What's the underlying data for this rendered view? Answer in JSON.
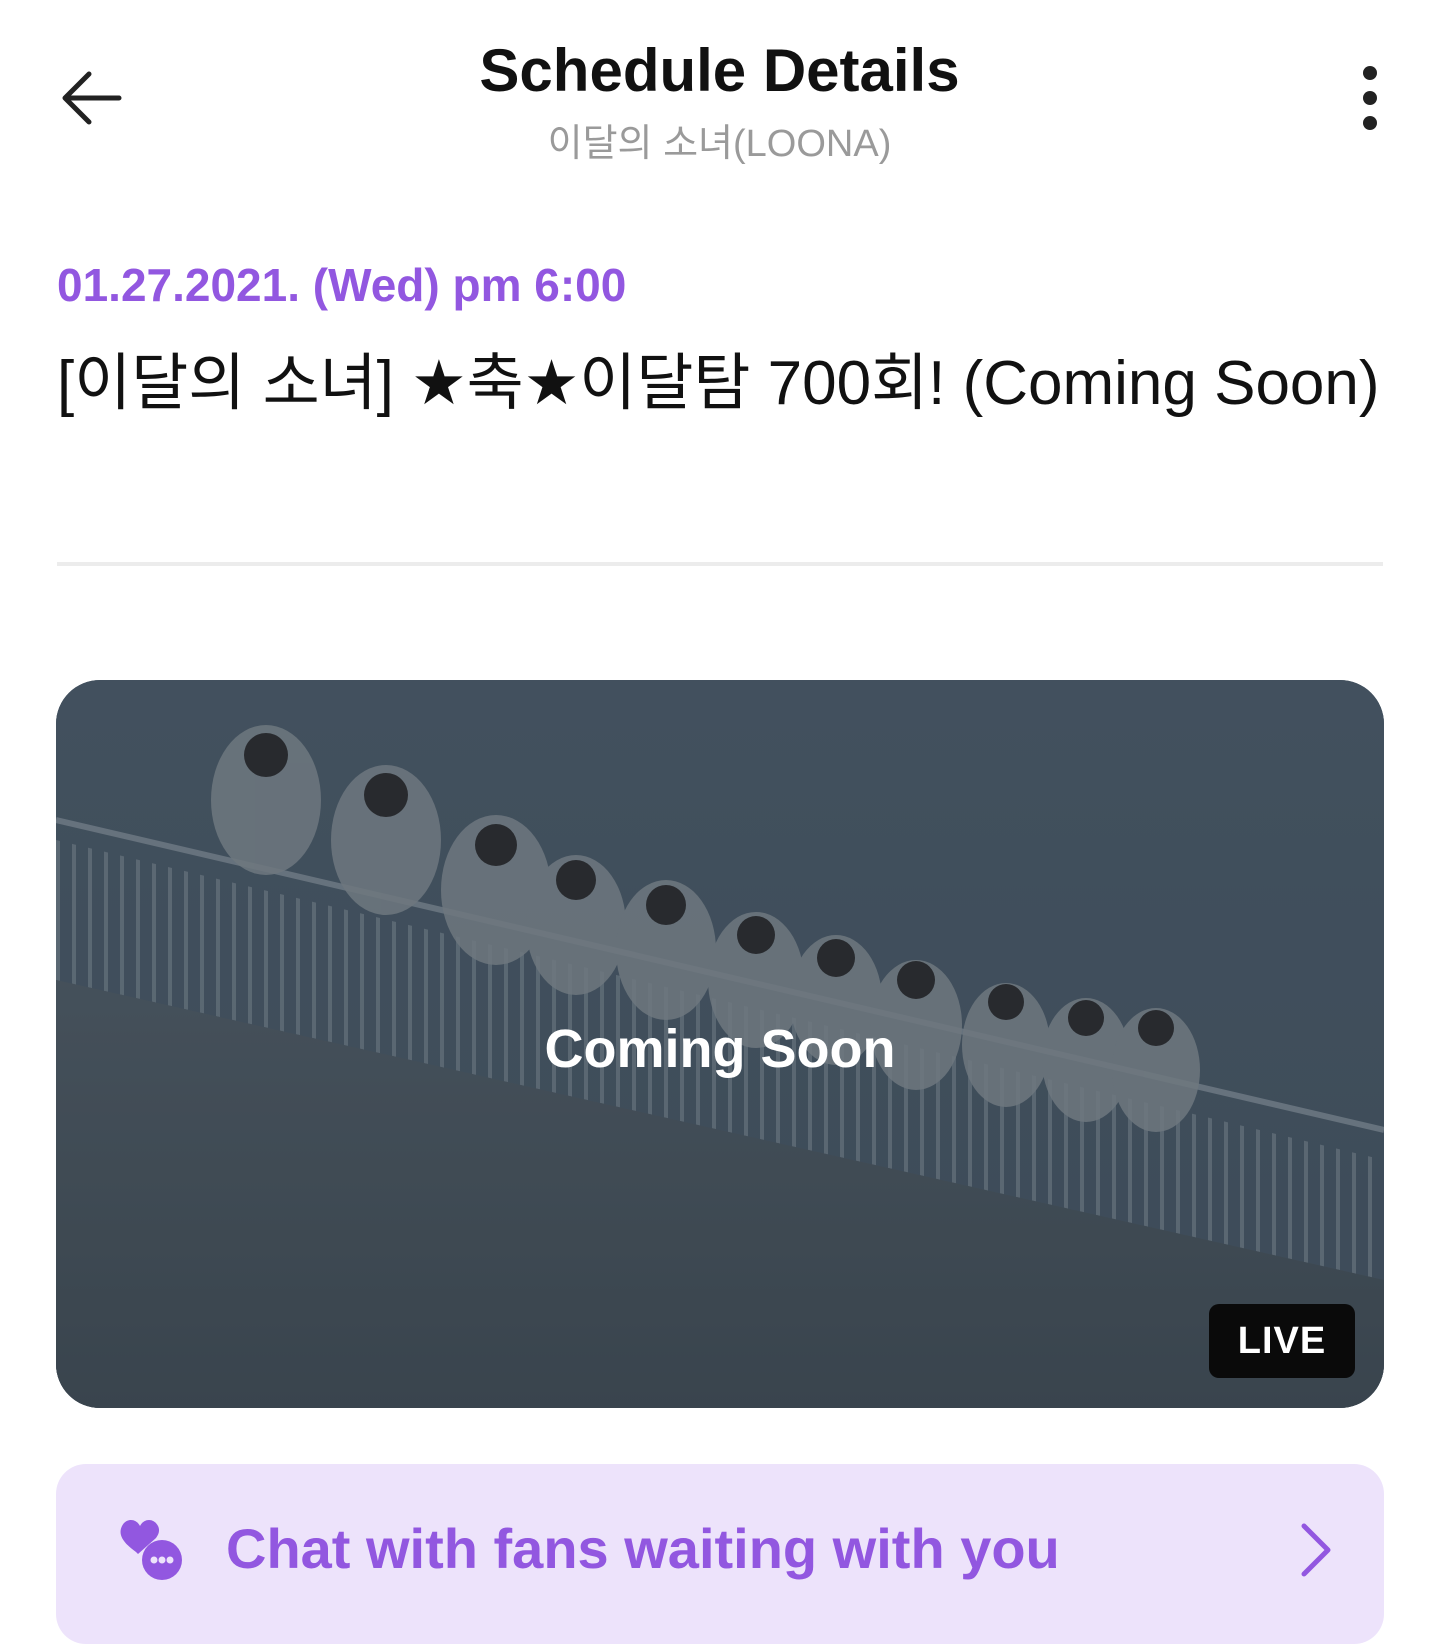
{
  "header": {
    "title": "Schedule Details",
    "subtitle": "이달의 소녀(LOONA)",
    "back_icon": "arrow-left-icon",
    "more_icon": "more-vertical-icon"
  },
  "event": {
    "date": "01.27.2021. (Wed) pm 6:00",
    "title": "[이달의 소녀] ★축★이달탐 700회! (Coming Soon)"
  },
  "video": {
    "overlay_text": "Coming Soon",
    "badge": "LIVE"
  },
  "chat": {
    "label": "Chat with fans waiting with you",
    "icon": "heart-chat-icon",
    "chevron_icon": "chevron-right-icon"
  },
  "colors": {
    "accent": "#9257e0",
    "banner_bg": "#ede3fb",
    "subtitle": "#9a9a9a",
    "badge_bg": "#0a0a0a"
  }
}
